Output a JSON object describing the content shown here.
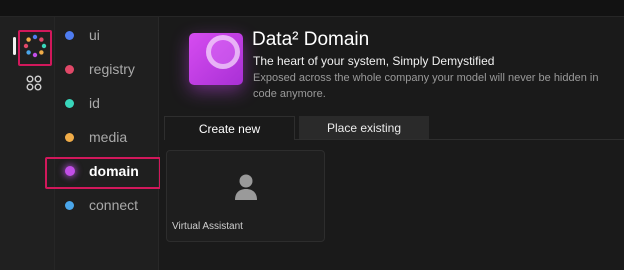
{
  "nav": {
    "items": [
      {
        "label": "ui",
        "color": "#4e7cf0"
      },
      {
        "label": "registry",
        "color": "#e04868"
      },
      {
        "label": "id",
        "color": "#39d6bb"
      },
      {
        "label": "media",
        "color": "#f0ac48"
      },
      {
        "label": "domain",
        "color": "#c24ee8",
        "active": true
      },
      {
        "label": "connect",
        "color": "#4aa6ea"
      }
    ]
  },
  "rail": {
    "icons": [
      "apps-ring-icon",
      "grid-icon"
    ]
  },
  "header": {
    "title": "Data² Domain",
    "subtitle": "The heart of your system, Simply  Demystified",
    "description": "Exposed across the whole company your model will never be hidden in code anymore.",
    "accent_color": "#c24ee8"
  },
  "tabs": [
    {
      "label": "Create new",
      "active": true
    },
    {
      "label": "Place existing",
      "active": false
    }
  ],
  "cards": [
    {
      "label": "Virtual Assistant",
      "icon": "user-icon"
    }
  ],
  "highlight_color": "#d1185b"
}
